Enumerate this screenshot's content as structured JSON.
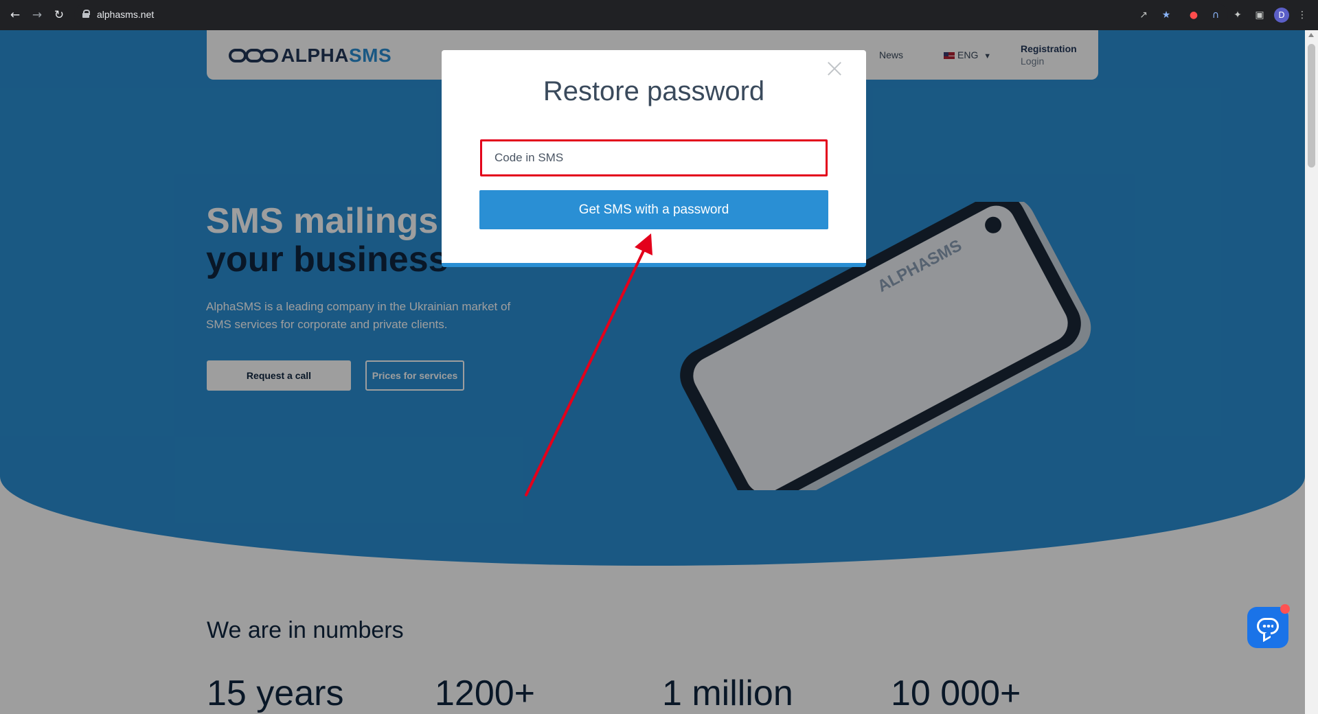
{
  "browser": {
    "url": "alphasms.net",
    "profile_initial": "D",
    "nav_icons": [
      "back-icon",
      "forward-icon",
      "reload-icon"
    ],
    "toolbar_icons": [
      "share-icon",
      "bookmark-star-icon",
      "extension-red-icon",
      "extension-arc-icon",
      "puzzle-icon",
      "sidebar-icon",
      "menu-icon"
    ]
  },
  "header": {
    "logo_part1": "ALPHA",
    "logo_part2": "SMS",
    "nav_news": "News",
    "lang": "ENG",
    "registration": "Registration",
    "login": "Login"
  },
  "hero": {
    "title_line1": "SMS mailings",
    "title_line2": "your business",
    "subtitle": "AlphaSMS is a leading company in the Ukrainian market of SMS services for corporate and private clients.",
    "btn_call": "Request a call",
    "btn_prices": "Prices for services"
  },
  "numbers": {
    "title": "We are in numbers",
    "items": [
      "15 years",
      "1200+",
      "1 million",
      "10 000+"
    ]
  },
  "modal": {
    "title": "Restore password",
    "input_placeholder": "Code in SMS",
    "button_label": "Get SMS with a password"
  },
  "colors": {
    "brand_blue": "#2a8fd4",
    "dark_navy": "#102640",
    "highlight_red": "#e3001b"
  }
}
